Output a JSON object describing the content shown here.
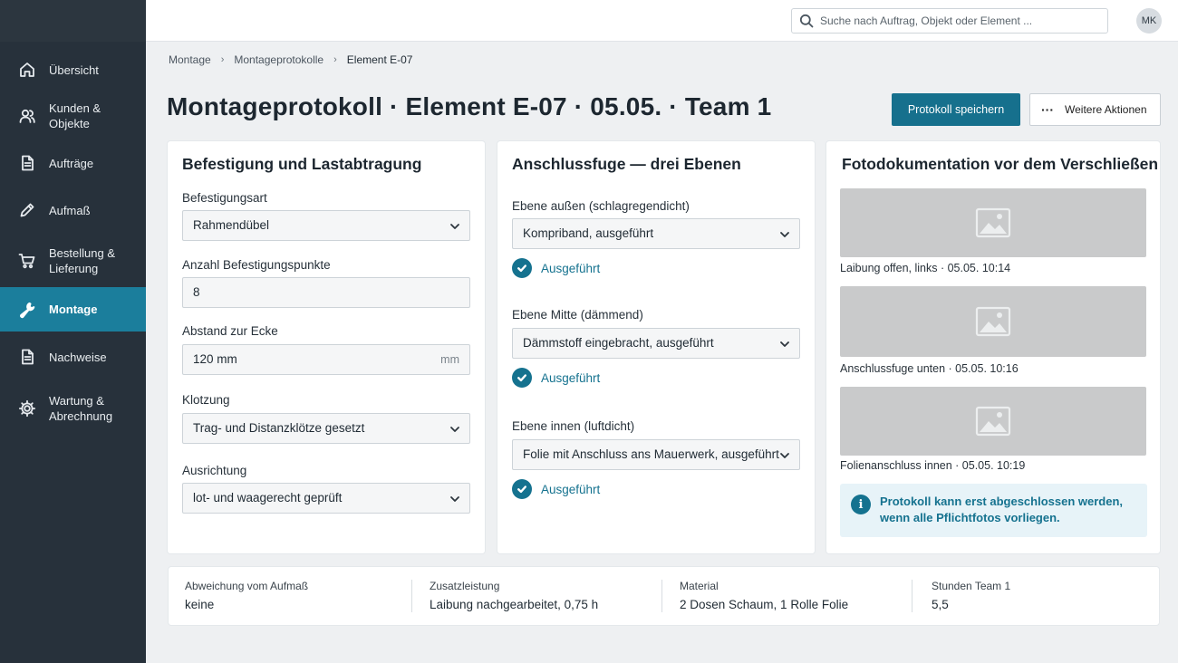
{
  "sidebar": {
    "items": [
      {
        "label": "Übersicht",
        "icon": "home-icon",
        "active": false
      },
      {
        "label": "Kunden & Objekte",
        "icon": "users-icon",
        "active": false
      },
      {
        "label": "Aufträge",
        "icon": "document-icon",
        "active": false
      },
      {
        "label": "Aufmaß",
        "icon": "pencil-icon",
        "active": false
      },
      {
        "label": "Bestellung & Lieferung",
        "icon": "cart-icon",
        "active": false
      },
      {
        "label": "Montage",
        "icon": "wrench-icon",
        "active": true
      },
      {
        "label": "Nachweise",
        "icon": "document-icon",
        "active": false
      },
      {
        "label": "Wartung & Abrechnung",
        "icon": "gear-icon",
        "active": false
      }
    ]
  },
  "topbar": {
    "search_placeholder": "Suche nach Auftrag, Objekt oder Element ...",
    "avatar_initials": "MK"
  },
  "breadcrumb": [
    "Montage",
    "Montageprotokolle",
    "Element E-07"
  ],
  "page": {
    "title": "Montageprotokoll · Element E-07 · 05.05. · Team 1",
    "save_button": "Protokoll speichern",
    "more_button": "Weitere Aktionen"
  },
  "befestigung": {
    "title": "Befestigung und Lastabtragung",
    "art_label": "Befestigungsart",
    "art_value": "Rahmendübel",
    "punkte_label": "Anzahl Befestigungspunkte",
    "punkte_value": "8",
    "abstand_label": "Abstand zur Ecke",
    "abstand_value": "120 mm",
    "abstand_unit": "mm",
    "klotzung_label": "Klotzung",
    "klotzung_value": "Trag- und Distanzklötze gesetzt",
    "ausrichtung_label": "Ausrichtung",
    "ausrichtung_value": "lot- und waagerecht geprüft"
  },
  "anschlussfuge": {
    "title": "Anschlussfuge — drei Ebenen",
    "aussen_label": "Ebene außen (schlagregendicht)",
    "aussen_value": "Kompriband, ausgeführt",
    "aussen_status": "Ausgeführt",
    "mitte_label": "Ebene Mitte (dämmend)",
    "mitte_value": "Dämmstoff eingebracht, ausgeführt",
    "mitte_status": "Ausgeführt",
    "innen_label": "Ebene innen (luftdicht)",
    "innen_value": "Folie mit Anschluss ans Mauerwerk, ausgeführt",
    "innen_status": "Ausgeführt"
  },
  "fotos": {
    "title": "Fotodokumentation vor dem Verschließen",
    "captions": [
      "Laibung offen, links · 05.05. 10:14",
      "Anschlussfuge unten · 05.05. 10:16",
      "Folienanschluss innen · 05.05. 10:19"
    ],
    "info": "Protokoll kann erst abgeschlossen werden, wenn alle Pflichtfotos vorliegen."
  },
  "summary": [
    {
      "label": "Abweichung vom Aufmaß",
      "value": "keine"
    },
    {
      "label": "Zusatzleistung",
      "value": "Laibung nachgearbeitet, 0,75 h"
    },
    {
      "label": "Material",
      "value": "2 Dosen Schaum, 1 Rolle Folie"
    },
    {
      "label": "Stunden Team 1",
      "value": "5,5"
    }
  ],
  "colors": {
    "sidebar": "#27313b",
    "accent": "#16708d",
    "active_nav": "#1b7e9c",
    "info_bg": "#e7f3f8"
  }
}
